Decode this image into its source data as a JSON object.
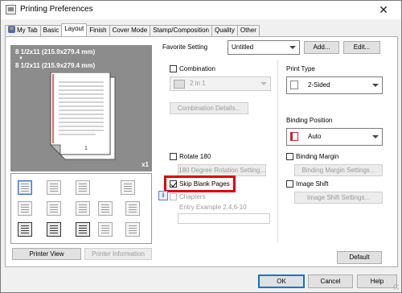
{
  "window": {
    "title": "Printing Preferences",
    "close_glyph": "✕"
  },
  "tabs": [
    "My Tab",
    "Basic",
    "Layout",
    "Finish",
    "Cover Mode",
    "Stamp/Composition",
    "Quality",
    "Other"
  ],
  "active_tab": "Layout",
  "favorite": {
    "label": "Favorite Setting",
    "value": "Untitled",
    "add": "Add...",
    "edit": "Edit..."
  },
  "preview": {
    "size_line1": "8 1/2x11 (215.9x279.4 mm)",
    "arrow": "▼",
    "size_line2": "8 1/2x11 (215.9x279.4 mm)",
    "copies": "x1"
  },
  "combination": {
    "label": "Combination",
    "value": "2 in 1",
    "details": "Combination Details..."
  },
  "rotate": {
    "label": "Rotate 180",
    "setting": "180 Degree Rotation Setting..."
  },
  "skip_blank": {
    "label": "Skip Blank Pages",
    "checked": true
  },
  "chapters": {
    "label": "Chapters",
    "example": "Entry Example 2,4,6-10",
    "value": ""
  },
  "print_type": {
    "label": "Print Type",
    "value": "2-Sided"
  },
  "binding_position": {
    "label": "Binding Position",
    "value": "Auto"
  },
  "binding_margin": {
    "label": "Binding Margin",
    "settings": "Binding Margin Settings..."
  },
  "image_shift": {
    "label": "Image Shift",
    "settings": "Image Shift Settings..."
  },
  "left_buttons": {
    "printer_view": "Printer View",
    "printer_info": "Printer Information"
  },
  "default_button": "Default",
  "footer": {
    "ok": "OK",
    "cancel": "Cancel",
    "help": "Help"
  },
  "info_glyph": "i",
  "colors": {
    "highlight": "#e00000",
    "accent": "#0078d7",
    "preview_bg": "#8c8c8c"
  }
}
